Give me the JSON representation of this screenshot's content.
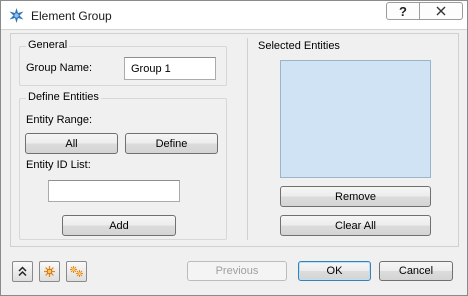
{
  "window": {
    "title": "Element Group",
    "help_icon": "question-mark-icon",
    "help_label": "?",
    "close_icon": "close-icon"
  },
  "general": {
    "legend": "General",
    "group_name_label": "Group Name:",
    "group_name_value": "Group 1"
  },
  "define_entities": {
    "legend": "Define Entities",
    "entity_range_label": "Entity Range:",
    "all_button": "All",
    "define_button": "Define",
    "entity_id_list_label": "Entity ID List:",
    "entity_id_list_value": "",
    "add_button": "Add"
  },
  "selected_entities": {
    "legend": "Selected Entities",
    "items": [],
    "remove_button": "Remove",
    "clear_all_button": "Clear All"
  },
  "footer": {
    "tool_icons": [
      "collapse-up-icon",
      "highlight-icon",
      "highlight-all-icon"
    ],
    "previous_button": "Previous",
    "ok_button": "OK",
    "cancel_button": "Cancel"
  },
  "colors": {
    "list_background": "#cfe3f5",
    "tool_icon_accent": "#e8861a"
  }
}
